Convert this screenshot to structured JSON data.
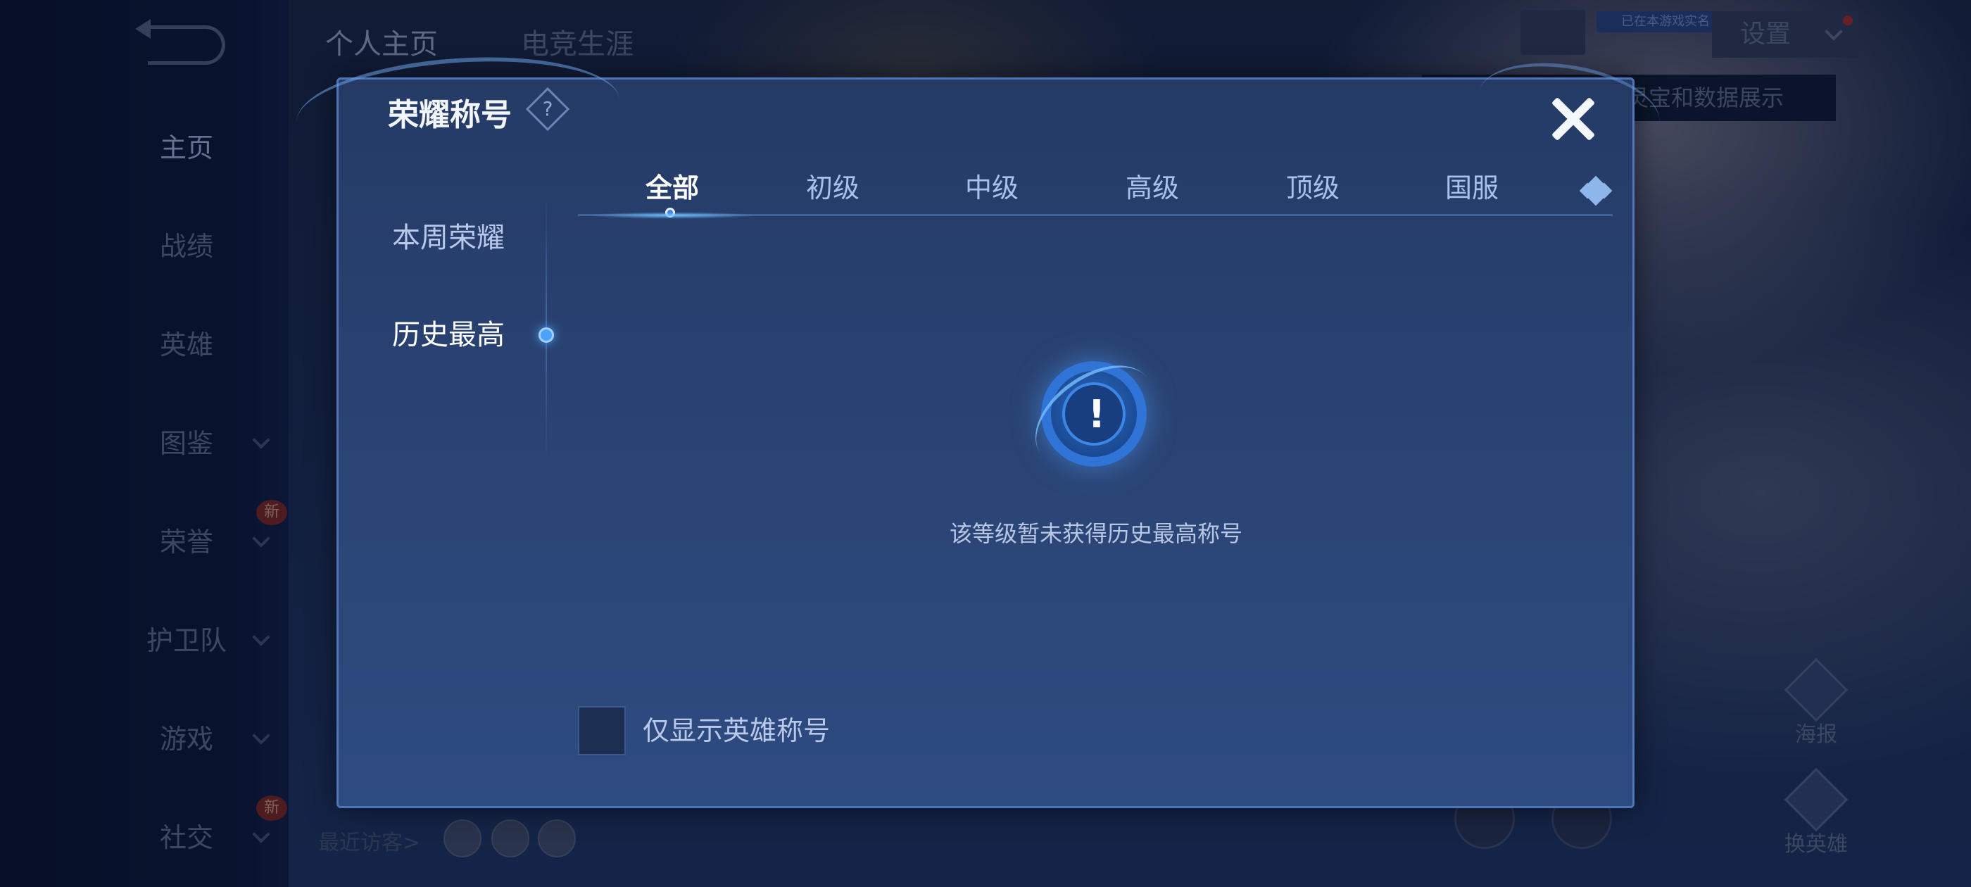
{
  "background": {
    "back_icon": "back-arrow-icon",
    "nav_items": [
      {
        "label": "主页",
        "active": true,
        "has_arrow": false,
        "badge": ""
      },
      {
        "label": "战绩",
        "active": false,
        "has_arrow": false,
        "badge": ""
      },
      {
        "label": "英雄",
        "active": false,
        "has_arrow": false,
        "badge": ""
      },
      {
        "label": "图鉴",
        "active": false,
        "has_arrow": true,
        "badge": ""
      },
      {
        "label": "荣誉",
        "active": false,
        "has_arrow": true,
        "badge": "新"
      },
      {
        "label": "护卫队",
        "active": false,
        "has_arrow": true,
        "badge": ""
      },
      {
        "label": "游戏",
        "active": false,
        "has_arrow": true,
        "badge": ""
      },
      {
        "label": "社交",
        "active": false,
        "has_arrow": true,
        "badge": "新"
      }
    ],
    "top_tabs": [
      "个人主页",
      "电竞生涯"
    ],
    "verified_tag": "已在本游戏实名",
    "settings_label": "设置",
    "tooltip_text": "灵宝和数据展示",
    "side_buttons": [
      "海报",
      "换英雄"
    ],
    "visitors_label": "最近访客>"
  },
  "modal": {
    "title": "荣耀称号",
    "help_symbol": "?",
    "close_icon": "close-icon",
    "side_tabs": [
      {
        "label": "本周荣耀",
        "active": false
      },
      {
        "label": "历史最高",
        "active": true
      }
    ],
    "level_tabs": [
      {
        "label": "全部",
        "active": true
      },
      {
        "label": "初级",
        "active": false
      },
      {
        "label": "中级",
        "active": false
      },
      {
        "label": "高级",
        "active": false
      },
      {
        "label": "顶级",
        "active": false
      },
      {
        "label": "国服",
        "active": false
      }
    ],
    "empty_state": {
      "icon": "exclamation-badge-icon",
      "symbol": "!",
      "message": "该等级暂未获得历史最高称号"
    },
    "filter_checkbox": {
      "label": "仅显示英雄称号",
      "checked": false
    }
  },
  "colors": {
    "modal_bg": "#253b66",
    "accent_blue": "#4aa3ff",
    "active_text": "#ffffff",
    "inactive_text": "#a9c2ec"
  }
}
